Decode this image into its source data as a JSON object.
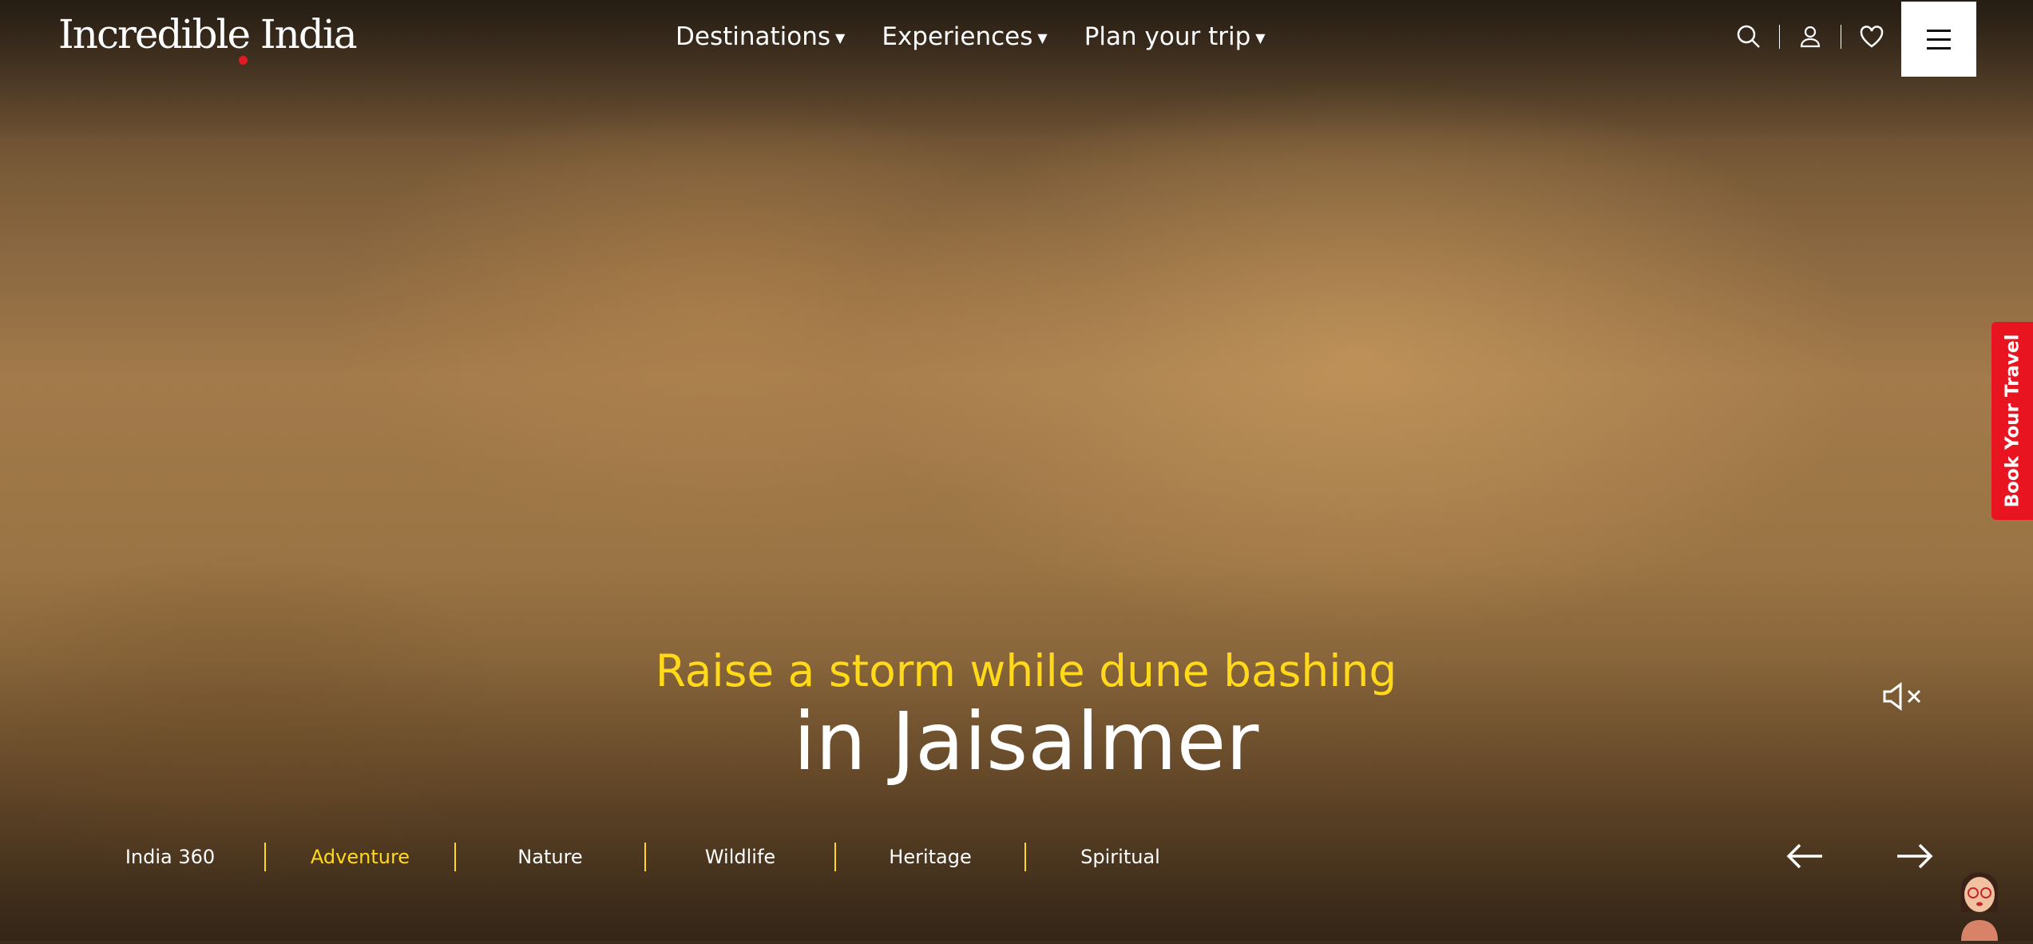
{
  "header": {
    "logo": "Incredible India",
    "nav": [
      {
        "label": "Destinations"
      },
      {
        "label": "Experiences"
      },
      {
        "label": "Plan your trip"
      }
    ],
    "icons": [
      "search-icon",
      "user-icon",
      "heart-icon",
      "hamburger-menu-icon"
    ]
  },
  "side_tab": {
    "label": "Book Your Travel",
    "color": "#e8141f"
  },
  "hero": {
    "tagline": "Raise a storm while dune bashing",
    "place": "in Jaisalmer",
    "tagline_color": "#ffd91a"
  },
  "categories": [
    {
      "label": "India 360"
    },
    {
      "label": "Adventure",
      "active": true
    },
    {
      "label": "Nature"
    },
    {
      "label": "Wildlife"
    },
    {
      "label": "Heritage"
    },
    {
      "label": "Spiritual"
    }
  ],
  "controls": {
    "mute": "mute-icon",
    "prev": "arrow-left-icon",
    "next": "arrow-right-icon",
    "assistant": "chat-avatar"
  }
}
